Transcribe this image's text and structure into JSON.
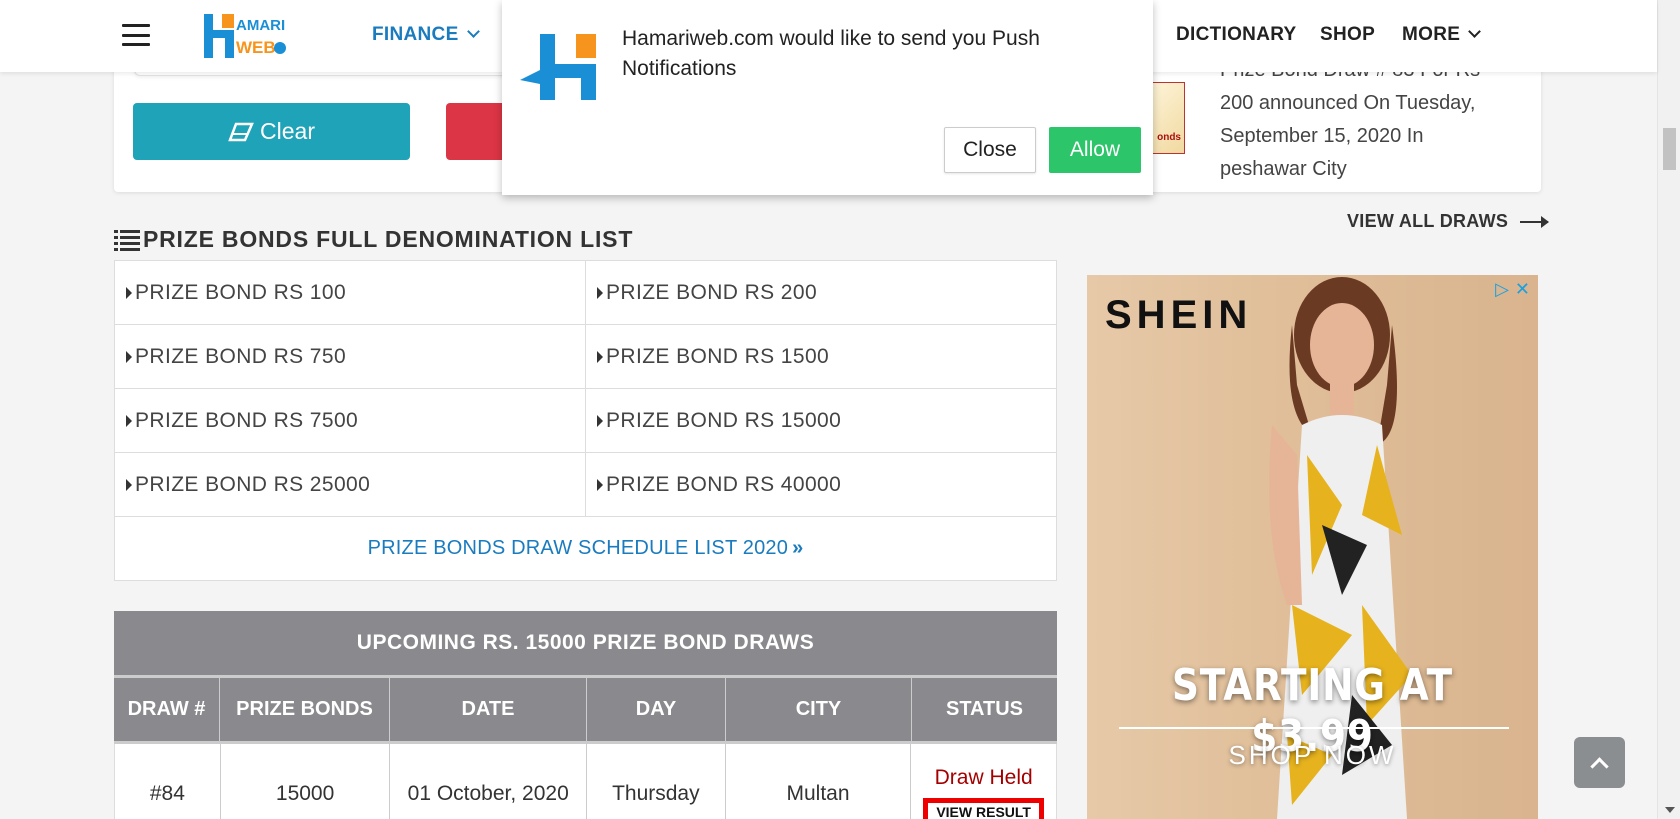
{
  "header": {
    "nav": {
      "finance": "FINANCE",
      "dictionary": "DICTIONARY",
      "shop": "SHOP",
      "more": "MORE"
    }
  },
  "toolbar": {
    "clear_label": "Clear"
  },
  "notification": {
    "message": "Hamariweb.com would like to send you Push Notifications",
    "close_label": "Close",
    "allow_label": "Allow"
  },
  "news": {
    "text": "Prize Bond Draw # 83 For Rs 200 announced On Tuesday, September 15, 2020 In peshawar City",
    "thumb_text": "onds",
    "view_all": "VIEW ALL DRAWS"
  },
  "denomination": {
    "title": "PRIZE BONDS FULL DENOMINATION LIST",
    "items": [
      "PRIZE BOND RS 100",
      "PRIZE BOND RS 200",
      "PRIZE BOND RS 750",
      "PRIZE BOND RS 1500",
      "PRIZE BOND RS 7500",
      "PRIZE BOND RS 15000",
      "PRIZE BOND RS 25000",
      "PRIZE BOND RS 40000"
    ],
    "schedule_link": "PRIZE BONDS DRAW SCHEDULE LIST 2020"
  },
  "upcoming": {
    "title": "UPCOMING RS. 15000 PRIZE BOND DRAWS",
    "headers": [
      "DRAW #",
      "PRIZE BONDS",
      "DATE",
      "DAY",
      "CITY",
      "STATUS"
    ],
    "rows": [
      {
        "draw": "#84",
        "bonds": "15000",
        "date": "01 October, 2020",
        "day": "Thursday",
        "city": "Multan",
        "status": "Draw Held",
        "action": "VIEW RESULT"
      }
    ]
  },
  "ad": {
    "brand": "SHEIN",
    "offer": "STARTING AT  $3.99",
    "cta": "SHOP NOW"
  },
  "colors": {
    "brand_blue": "#1a7bbf",
    "teal_button": "#1fa3b8",
    "red_button": "#dc3545",
    "allow_green": "#2cc56a",
    "table_header": "#8a8a8e"
  }
}
